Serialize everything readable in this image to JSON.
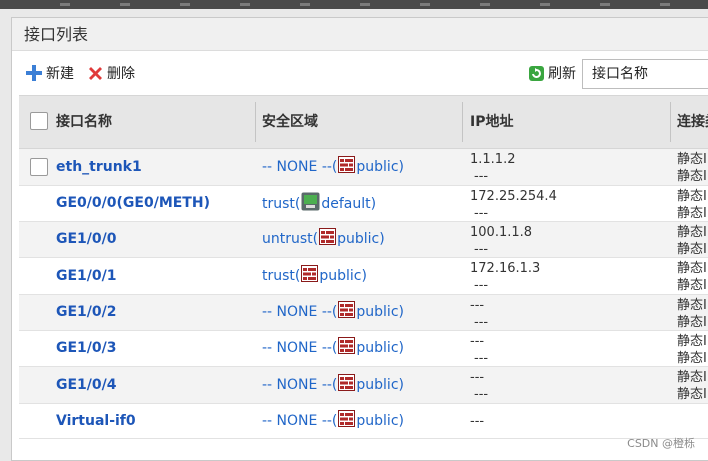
{
  "panel": {
    "title": "接口列表"
  },
  "toolbar": {
    "new_label": "新建",
    "delete_label": "删除",
    "refresh_label": "刷新",
    "search_value": "接口名称"
  },
  "table": {
    "headers": [
      "接口名称",
      "安全区域",
      "IP地址",
      "连接类型"
    ],
    "rows": [
      {
        "name": "eth_trunk1",
        "zone_prefix": "-- NONE --(",
        "zone_name": " public)",
        "zone_icon": "firewall-icon",
        "ip1": "1.1.1.2",
        "ip2": "---",
        "conn1": "静态IP",
        "conn2": "静态IP",
        "checkbox": true
      },
      {
        "name": "GE0/0/0(GE0/METH)",
        "zone_prefix": "trust(",
        "zone_name": " default)",
        "zone_icon": "network-icon",
        "ip1": "172.25.254.4",
        "ip2": "---",
        "conn1": "静态IP",
        "conn2": "静态IP",
        "checkbox": false
      },
      {
        "name": "GE1/0/0",
        "zone_prefix": "untrust(",
        "zone_name": " public)",
        "zone_icon": "firewall-icon",
        "ip1": "100.1.1.8",
        "ip2": "---",
        "conn1": "静态IP",
        "conn2": "静态IP",
        "checkbox": false
      },
      {
        "name": "GE1/0/1",
        "zone_prefix": "trust(",
        "zone_name": " public)",
        "zone_icon": "firewall-icon",
        "ip1": "172.16.1.3",
        "ip2": "---",
        "conn1": "静态IP",
        "conn2": "静态IP",
        "checkbox": false
      },
      {
        "name": "GE1/0/2",
        "zone_prefix": "-- NONE --(",
        "zone_name": " public)",
        "zone_icon": "firewall-icon",
        "ip1": "---",
        "ip2": "---",
        "conn1": "静态IP",
        "conn2": "静态IP",
        "checkbox": false
      },
      {
        "name": "GE1/0/3",
        "zone_prefix": "-- NONE --(",
        "zone_name": " public)",
        "zone_icon": "firewall-icon",
        "ip1": "---",
        "ip2": "---",
        "conn1": "静态IP",
        "conn2": "静态IP",
        "checkbox": false
      },
      {
        "name": "GE1/0/4",
        "zone_prefix": "-- NONE --(",
        "zone_name": " public)",
        "zone_icon": "firewall-icon",
        "ip1": "---",
        "ip2": "---",
        "conn1": "静态IP",
        "conn2": "静态IP",
        "checkbox": false
      },
      {
        "name": "Virtual-if0",
        "zone_prefix": "-- NONE --(",
        "zone_name": " public)",
        "zone_icon": "firewall-icon",
        "ip1": "---",
        "ip2": "",
        "conn1": "",
        "conn2": "",
        "checkbox": false
      }
    ]
  },
  "watermark": "CSDN @橙栎",
  "colors": {
    "link": "#1d56b8",
    "zone": "#2066c8",
    "header_bg": "#e6e6e6",
    "alt_row": "#f3f3f3"
  }
}
